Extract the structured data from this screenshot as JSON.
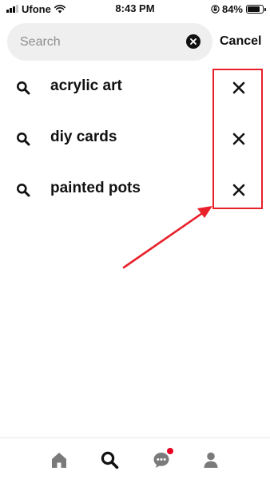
{
  "status_bar": {
    "carrier": "Ufone",
    "time": "8:43 PM",
    "battery_percent": "84%",
    "battery_level": 0.84,
    "icons": [
      "signal-icon",
      "wifi-icon",
      "orientation-lock-icon",
      "battery-icon"
    ]
  },
  "search": {
    "placeholder": "Search",
    "value": "",
    "clear_icon": "clear-icon",
    "cancel_label": "Cancel"
  },
  "history": {
    "items": [
      {
        "label": "acrylic art",
        "icon": "search-icon",
        "remove_icon": "close-icon"
      },
      {
        "label": "diy cards",
        "icon": "search-icon",
        "remove_icon": "close-icon"
      },
      {
        "label": "painted pots",
        "icon": "search-icon",
        "remove_icon": "close-icon"
      }
    ]
  },
  "annotation": {
    "color": "#e8202a"
  },
  "tab_bar": {
    "tabs": [
      {
        "name": "home",
        "icon": "home-icon",
        "active": false
      },
      {
        "name": "search",
        "icon": "search-icon",
        "active": true
      },
      {
        "name": "messages",
        "icon": "chat-icon",
        "active": false,
        "has_notification": true
      },
      {
        "name": "profile",
        "icon": "profile-icon",
        "active": false
      }
    ]
  },
  "colors": {
    "accent": "#e60023",
    "text": "#111111",
    "muted": "#8e8e8e",
    "search_bg": "#efefef"
  }
}
